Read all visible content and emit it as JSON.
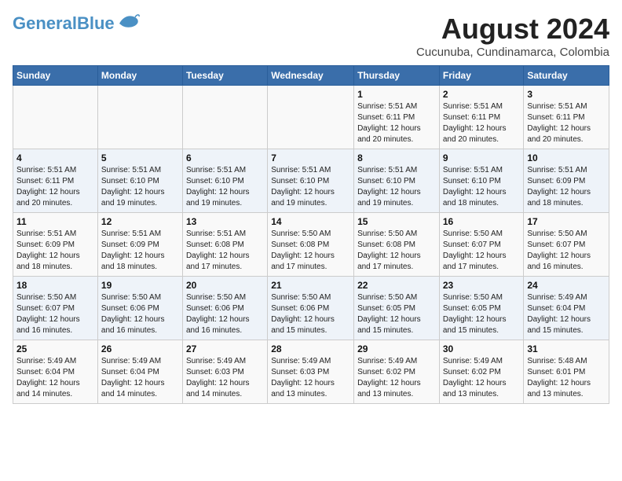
{
  "header": {
    "logo_general": "General",
    "logo_blue": "Blue",
    "month_year": "August 2024",
    "location": "Cucunuba, Cundinamarca, Colombia"
  },
  "days_of_week": [
    "Sunday",
    "Monday",
    "Tuesday",
    "Wednesday",
    "Thursday",
    "Friday",
    "Saturday"
  ],
  "weeks": [
    [
      {
        "day": "",
        "info": ""
      },
      {
        "day": "",
        "info": ""
      },
      {
        "day": "",
        "info": ""
      },
      {
        "day": "",
        "info": ""
      },
      {
        "day": "1",
        "info": "Sunrise: 5:51 AM\nSunset: 6:11 PM\nDaylight: 12 hours\nand 20 minutes."
      },
      {
        "day": "2",
        "info": "Sunrise: 5:51 AM\nSunset: 6:11 PM\nDaylight: 12 hours\nand 20 minutes."
      },
      {
        "day": "3",
        "info": "Sunrise: 5:51 AM\nSunset: 6:11 PM\nDaylight: 12 hours\nand 20 minutes."
      }
    ],
    [
      {
        "day": "4",
        "info": "Sunrise: 5:51 AM\nSunset: 6:11 PM\nDaylight: 12 hours\nand 20 minutes."
      },
      {
        "day": "5",
        "info": "Sunrise: 5:51 AM\nSunset: 6:10 PM\nDaylight: 12 hours\nand 19 minutes."
      },
      {
        "day": "6",
        "info": "Sunrise: 5:51 AM\nSunset: 6:10 PM\nDaylight: 12 hours\nand 19 minutes."
      },
      {
        "day": "7",
        "info": "Sunrise: 5:51 AM\nSunset: 6:10 PM\nDaylight: 12 hours\nand 19 minutes."
      },
      {
        "day": "8",
        "info": "Sunrise: 5:51 AM\nSunset: 6:10 PM\nDaylight: 12 hours\nand 19 minutes."
      },
      {
        "day": "9",
        "info": "Sunrise: 5:51 AM\nSunset: 6:10 PM\nDaylight: 12 hours\nand 18 minutes."
      },
      {
        "day": "10",
        "info": "Sunrise: 5:51 AM\nSunset: 6:09 PM\nDaylight: 12 hours\nand 18 minutes."
      }
    ],
    [
      {
        "day": "11",
        "info": "Sunrise: 5:51 AM\nSunset: 6:09 PM\nDaylight: 12 hours\nand 18 minutes."
      },
      {
        "day": "12",
        "info": "Sunrise: 5:51 AM\nSunset: 6:09 PM\nDaylight: 12 hours\nand 18 minutes."
      },
      {
        "day": "13",
        "info": "Sunrise: 5:51 AM\nSunset: 6:08 PM\nDaylight: 12 hours\nand 17 minutes."
      },
      {
        "day": "14",
        "info": "Sunrise: 5:50 AM\nSunset: 6:08 PM\nDaylight: 12 hours\nand 17 minutes."
      },
      {
        "day": "15",
        "info": "Sunrise: 5:50 AM\nSunset: 6:08 PM\nDaylight: 12 hours\nand 17 minutes."
      },
      {
        "day": "16",
        "info": "Sunrise: 5:50 AM\nSunset: 6:07 PM\nDaylight: 12 hours\nand 17 minutes."
      },
      {
        "day": "17",
        "info": "Sunrise: 5:50 AM\nSunset: 6:07 PM\nDaylight: 12 hours\nand 16 minutes."
      }
    ],
    [
      {
        "day": "18",
        "info": "Sunrise: 5:50 AM\nSunset: 6:07 PM\nDaylight: 12 hours\nand 16 minutes."
      },
      {
        "day": "19",
        "info": "Sunrise: 5:50 AM\nSunset: 6:06 PM\nDaylight: 12 hours\nand 16 minutes."
      },
      {
        "day": "20",
        "info": "Sunrise: 5:50 AM\nSunset: 6:06 PM\nDaylight: 12 hours\nand 16 minutes."
      },
      {
        "day": "21",
        "info": "Sunrise: 5:50 AM\nSunset: 6:06 PM\nDaylight: 12 hours\nand 15 minutes."
      },
      {
        "day": "22",
        "info": "Sunrise: 5:50 AM\nSunset: 6:05 PM\nDaylight: 12 hours\nand 15 minutes."
      },
      {
        "day": "23",
        "info": "Sunrise: 5:50 AM\nSunset: 6:05 PM\nDaylight: 12 hours\nand 15 minutes."
      },
      {
        "day": "24",
        "info": "Sunrise: 5:49 AM\nSunset: 6:04 PM\nDaylight: 12 hours\nand 15 minutes."
      }
    ],
    [
      {
        "day": "25",
        "info": "Sunrise: 5:49 AM\nSunset: 6:04 PM\nDaylight: 12 hours\nand 14 minutes."
      },
      {
        "day": "26",
        "info": "Sunrise: 5:49 AM\nSunset: 6:04 PM\nDaylight: 12 hours\nand 14 minutes."
      },
      {
        "day": "27",
        "info": "Sunrise: 5:49 AM\nSunset: 6:03 PM\nDaylight: 12 hours\nand 14 minutes."
      },
      {
        "day": "28",
        "info": "Sunrise: 5:49 AM\nSunset: 6:03 PM\nDaylight: 12 hours\nand 13 minutes."
      },
      {
        "day": "29",
        "info": "Sunrise: 5:49 AM\nSunset: 6:02 PM\nDaylight: 12 hours\nand 13 minutes."
      },
      {
        "day": "30",
        "info": "Sunrise: 5:49 AM\nSunset: 6:02 PM\nDaylight: 12 hours\nand 13 minutes."
      },
      {
        "day": "31",
        "info": "Sunrise: 5:48 AM\nSunset: 6:01 PM\nDaylight: 12 hours\nand 13 minutes."
      }
    ]
  ]
}
